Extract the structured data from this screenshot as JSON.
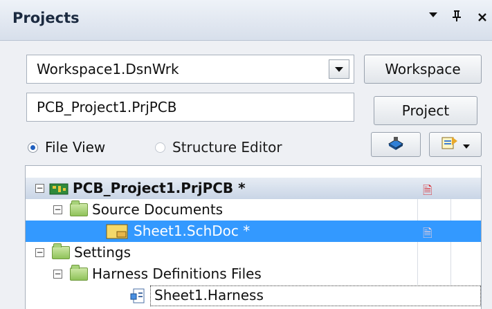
{
  "panel": {
    "title": "Projects",
    "pin_glyph": "ᵻ",
    "dropdown_glyph": "▾",
    "close_glyph": "✕"
  },
  "workspace": {
    "value": "Workspace1.DsnWrk",
    "button_label": "Workspace"
  },
  "project": {
    "value": "PCB_Project1.PrjPCB",
    "button_label": "Project"
  },
  "view_options": {
    "file_view_label": "File View",
    "structure_editor_label": "Structure Editor",
    "selected": "File View"
  },
  "tree": {
    "items": [
      {
        "label": "PCB_Project1.PrjPCB *",
        "icon": "pcb-project-icon",
        "expanded": true,
        "modified": true
      },
      {
        "label": "Source Documents",
        "icon": "folder-icon",
        "expanded": true
      },
      {
        "label": "Sheet1.SchDoc *",
        "icon": "schematic-doc-icon",
        "selected": true,
        "modified": true
      },
      {
        "label": "Settings",
        "icon": "folder-icon",
        "expanded": true
      },
      {
        "label": "Harness Definitions Files",
        "icon": "folder-icon",
        "expanded": true
      },
      {
        "label": "Sheet1.Harness",
        "icon": "harness-doc-icon",
        "focused": true
      }
    ]
  },
  "colors": {
    "selection": "#3399ff",
    "modified_marker": "#d9242b",
    "header_gradient_top": "#e6ecf4",
    "folder_green": "#8fc35a"
  }
}
